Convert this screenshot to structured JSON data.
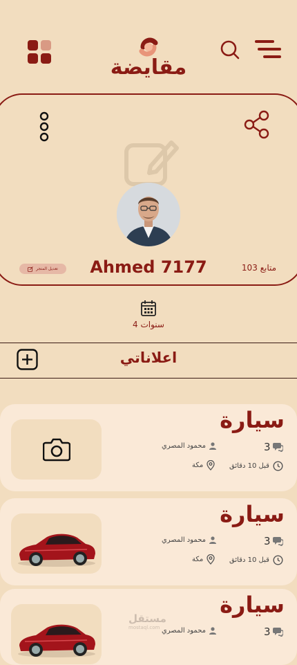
{
  "app": {
    "logo_text": "مقايضة"
  },
  "profile": {
    "username": "Ahmed 7177",
    "followers": "103 متابع",
    "edit_store_label": "تعديل المتجر",
    "membership": "4 سنوات"
  },
  "section": {
    "title": "اعلاناتي"
  },
  "listings": [
    {
      "title": "سيارة",
      "count": "3",
      "seller": "محمود المصري",
      "time": "قبل 10 دقائق",
      "location": "مكة",
      "has_image": false
    },
    {
      "title": "سيارة",
      "count": "3",
      "seller": "محمود المصري",
      "time": "قبل 10 دقائق",
      "location": "مكة",
      "has_image": true
    },
    {
      "title": "سيارة",
      "count": "3",
      "seller": "محمود المصري",
      "has_image": true
    }
  ],
  "watermark": {
    "text": "مستقل",
    "sub": "mostaql.com"
  },
  "colors": {
    "background": "#f2ddbf",
    "primary": "#8a1b14",
    "card": "#fae9d7"
  }
}
